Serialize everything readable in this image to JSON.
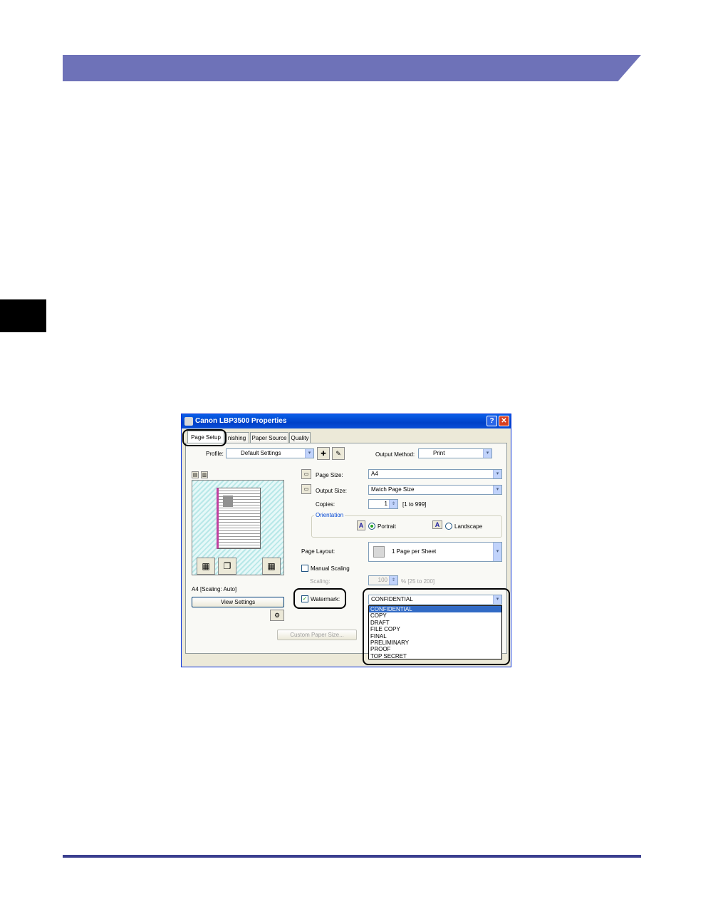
{
  "dialog": {
    "title": "Canon LBP3500 Properties",
    "help_button": "?",
    "close_button": "✕",
    "tabs": [
      {
        "label": "Page Setup"
      },
      {
        "label": "nishing"
      },
      {
        "label": "Paper Source"
      },
      {
        "label": "Quality"
      }
    ],
    "profile": {
      "label": "Profile:",
      "value": "Default Settings"
    },
    "output_method": {
      "label": "Output Method:",
      "value": "Print"
    },
    "page_size": {
      "label": "Page Size:",
      "value": "A4"
    },
    "output_size": {
      "label": "Output Size:",
      "value": "Match Page Size"
    },
    "copies": {
      "label": "Copies:",
      "value": "1",
      "range": "[1 to 999]"
    },
    "orientation": {
      "title": "Orientation",
      "portrait": "Portrait",
      "landscape": "Landscape",
      "glyph": "A"
    },
    "page_layout": {
      "label": "Page Layout:",
      "value": "1 Page per Sheet"
    },
    "manual_scaling": {
      "label": "Manual Scaling"
    },
    "scaling": {
      "label": "Scaling:",
      "value": "100",
      "range": "% [25 to 200]"
    },
    "watermark": {
      "label": "Watermark:",
      "value": "CONFIDENTIAL",
      "options": [
        "CONFIDENTIAL",
        "COPY",
        "DRAFT",
        "FILE COPY",
        "FINAL",
        "PRELIMINARY",
        "PROOF",
        "TOP SECRET"
      ]
    },
    "preview_caption": "A4 [Scaling: Auto]",
    "view_settings_button": "View Settings",
    "custom_paper_size_button": "Custom Paper Size...",
    "check_mark": "✓",
    "arrow_glyph": "▾"
  },
  "colors": {
    "header_band": "#6e72b8",
    "footer_rule": "#3a3f8f",
    "selection": "#316ac5"
  }
}
